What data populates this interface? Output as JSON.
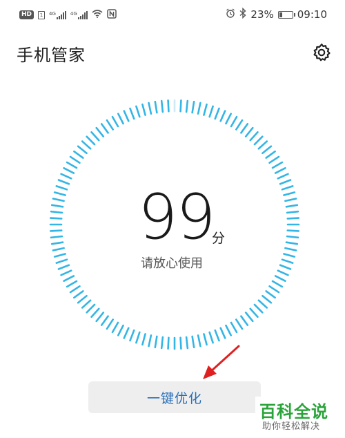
{
  "status_bar": {
    "hd_label": "HD",
    "sim_label": "1",
    "network1": "4G",
    "network2": "4G",
    "nfc_label": "N",
    "battery_percent": "23%",
    "battery_level": 0.23,
    "time": "09:10",
    "icons": [
      "alarm-icon",
      "bluetooth-icon",
      "wifi-icon",
      "nfc-icon"
    ]
  },
  "header": {
    "title": "手机管家",
    "settings_icon": "gear-icon"
  },
  "dial": {
    "score": "99",
    "unit": "分",
    "status": "请放心使用",
    "accent_color": "#33b5e5"
  },
  "actions": {
    "optimize_label": "一键优化"
  },
  "watermark": {
    "title": "百科全说",
    "subtitle": "助你轻松解决"
  }
}
